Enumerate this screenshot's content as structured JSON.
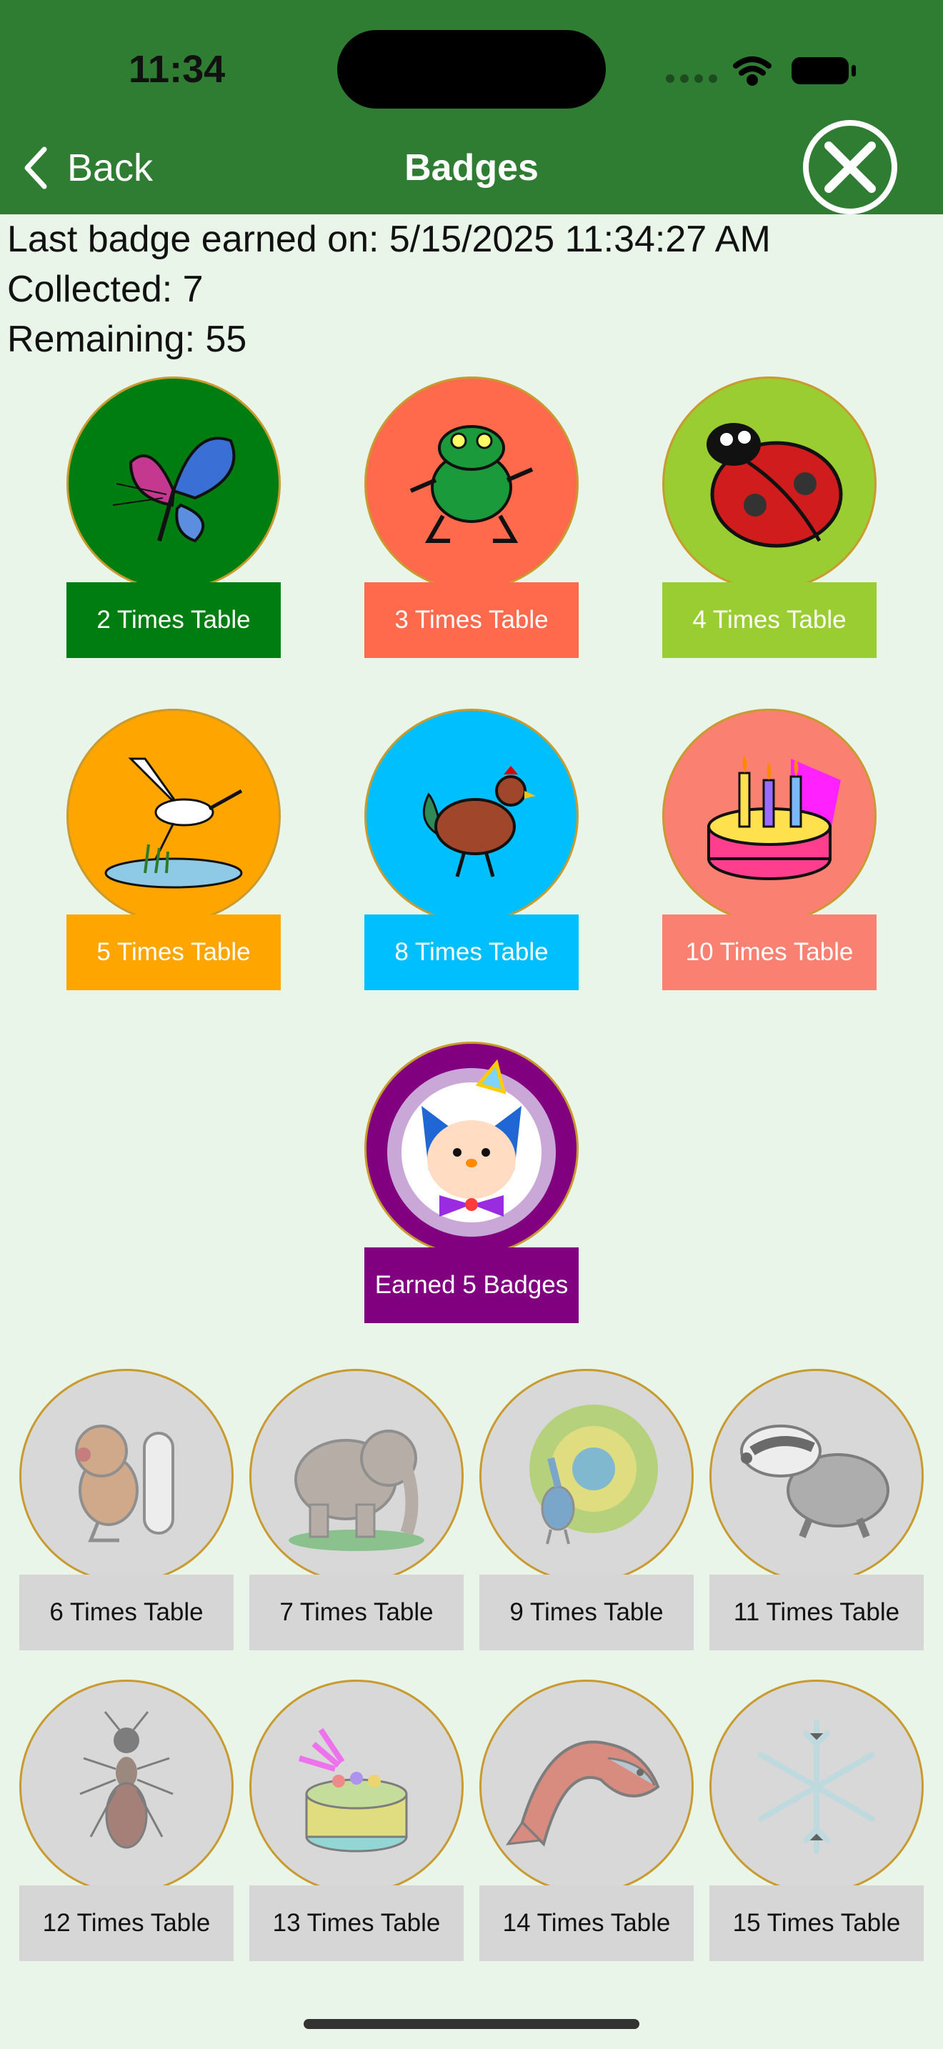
{
  "status_bar": {
    "time": "11:34"
  },
  "nav": {
    "back_label": "Back",
    "title": "Badges"
  },
  "info": {
    "last_earned": "Last badge earned on: 5/15/2025 11:34:27 AM",
    "collected": "Collected: 7",
    "remaining": "Remaining: 55"
  },
  "earned_badges": [
    {
      "label": "2 Times Table",
      "icon": "butterfly-icon",
      "color": "#007d10"
    },
    {
      "label": "3 Times Table",
      "icon": "frog-icon",
      "color": "#ff6a4d"
    },
    {
      "label": "4 Times Table",
      "icon": "ladybug-icon",
      "color": "#9acd32"
    },
    {
      "label": "5 Times Table",
      "icon": "heron-icon",
      "color": "#ffa500"
    },
    {
      "label": "8 Times Table",
      "icon": "rooster-icon",
      "color": "#00bfff"
    },
    {
      "label": "10 Times Table",
      "icon": "birthday-cake-icon",
      "color": "#fa8072"
    },
    {
      "label": "Earned 5 Badges",
      "icon": "party-cat-icon",
      "color": "#800080"
    }
  ],
  "locked_badges": [
    {
      "label": "6 Times Table",
      "icon": "dog-bone-icon"
    },
    {
      "label": "7 Times Table",
      "icon": "elephant-icon"
    },
    {
      "label": "9 Times Table",
      "icon": "peacock-icon"
    },
    {
      "label": "11 Times Table",
      "icon": "badger-icon"
    },
    {
      "label": "12 Times Table",
      "icon": "ant-icon"
    },
    {
      "label": "13 Times Table",
      "icon": "cake-icon"
    },
    {
      "label": "14 Times Table",
      "icon": "salmon-icon"
    },
    {
      "label": "15 Times Table",
      "icon": "snowflake-icon"
    }
  ]
}
